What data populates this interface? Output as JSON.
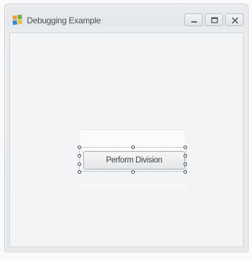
{
  "window": {
    "title": "Debugging Example",
    "icon": "windows-forms-app-icon",
    "caption_buttons": [
      "minimize-icon",
      "maximize-icon",
      "close-icon"
    ]
  },
  "form": {
    "selected_control": {
      "label": "Perform Division",
      "type": "button",
      "selected": true
    }
  },
  "colors": {
    "title_text": "#4a4f55",
    "window_chrome": "#e3e7ea",
    "client_background": "#f3f4f5",
    "handle_border": "#40454b"
  }
}
